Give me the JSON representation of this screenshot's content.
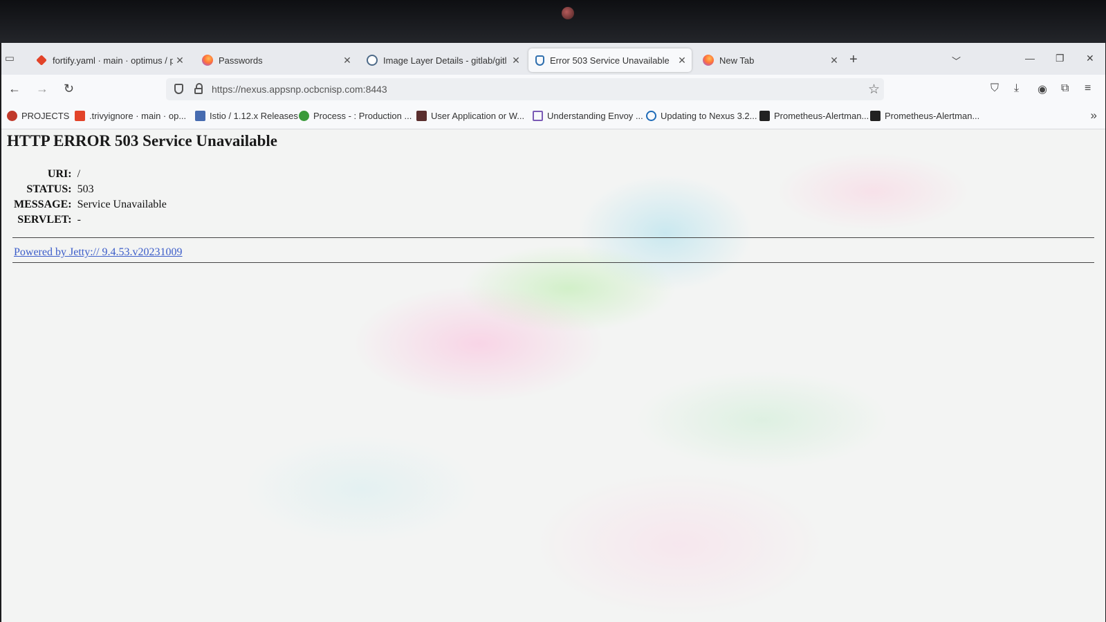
{
  "browser": {
    "tabs": [
      {
        "title": "fortify.yaml · main · optimus / p",
        "icon": "gitlab-icon"
      },
      {
        "title": "Passwords",
        "icon": "firefox-icon"
      },
      {
        "title": "Image Layer Details - gitlab/gitl",
        "icon": "docker-icon"
      },
      {
        "title": "Error 503 Service Unavailable",
        "icon": "shield-icon",
        "active": true
      },
      {
        "title": "New Tab",
        "icon": "firefox-icon"
      }
    ],
    "url": "https://nexus.appsnp.ocbcnisp.com:8443",
    "bookmarks": [
      {
        "label": "PROJECTS",
        "color": "#c0392b"
      },
      {
        "label": ".trivyignore · main · op...",
        "color": "#e24329"
      },
      {
        "label": "Istio / 1.12.x Releases",
        "color": "#466bb0"
      },
      {
        "label": "Process - : Production ...",
        "color": "#3a9a3a"
      },
      {
        "label": "User Application or W...",
        "color": "#5a2e2e"
      },
      {
        "label": "Understanding Envoy ...",
        "color": "#7a5ab5"
      },
      {
        "label": "Updating to Nexus 3.2...",
        "color": "#1e6bb8"
      },
      {
        "label": "Prometheus-Alertman...",
        "color": "#222222"
      },
      {
        "label": "Prometheus-Alertman...",
        "color": "#222222"
      }
    ]
  },
  "page": {
    "heading": "HTTP ERROR 503 Service Unavailable",
    "rows": [
      {
        "label": "URI:",
        "value": "/"
      },
      {
        "label": "STATUS:",
        "value": "503"
      },
      {
        "label": "MESSAGE:",
        "value": "Service Unavailable"
      },
      {
        "label": "SERVLET:",
        "value": "-"
      }
    ],
    "powered_by": "Powered by Jetty:// 9.4.53.v20231009"
  }
}
